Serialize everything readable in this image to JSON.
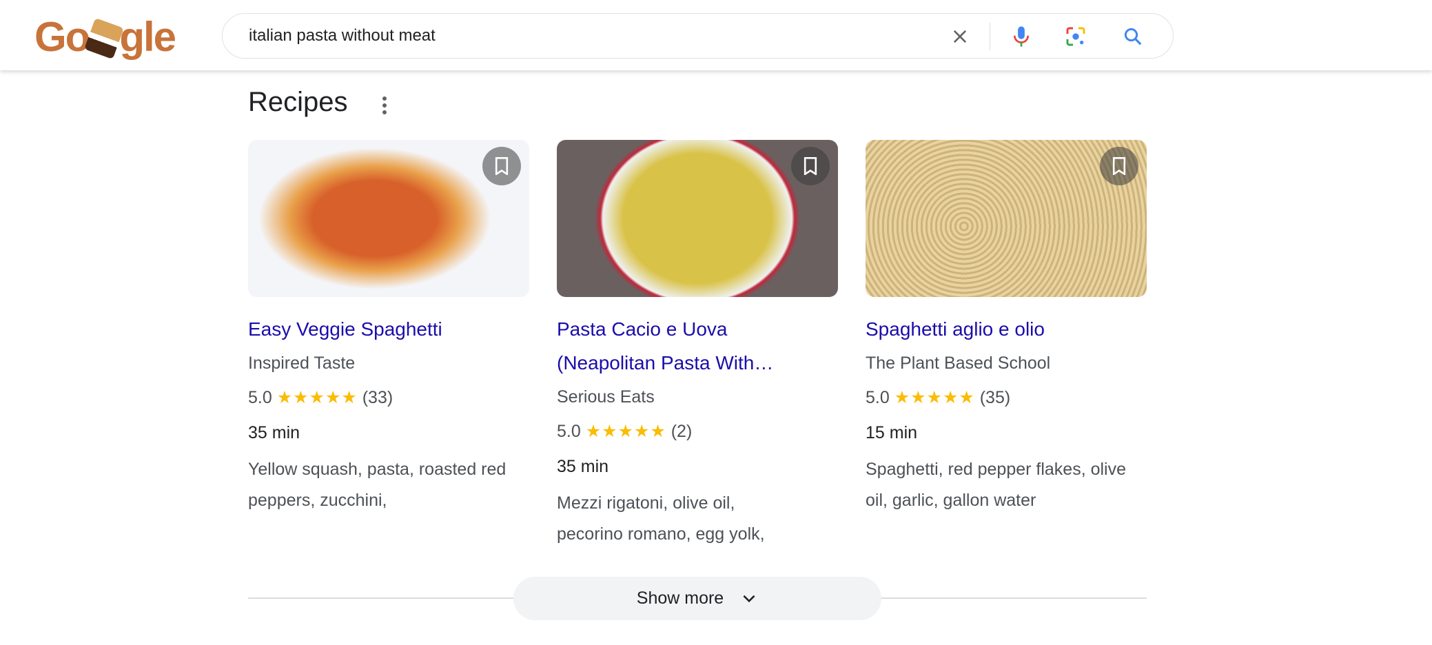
{
  "header": {
    "logo_text": "Google",
    "search_value": "italian pasta without meat",
    "icons": [
      "close-icon",
      "mic-icon",
      "lens-icon",
      "search-icon"
    ]
  },
  "section": {
    "title": "Recipes"
  },
  "recipes": [
    {
      "title": "Easy Veggie Spaghetti",
      "source": "Inspired Taste",
      "rating": "5.0",
      "stars": "★★★★★",
      "reviews": "(33)",
      "time": "35 min",
      "ingredients": "Yellow squash, pasta, roasted red peppers, zucchini,"
    },
    {
      "title": "Pasta Cacio e Uova (Neapolitan Pasta With…",
      "source": "Serious Eats",
      "rating": "5.0",
      "stars": "★★★★★",
      "reviews": "(2)",
      "time": "35 min",
      "ingredients": "Mezzi rigatoni, olive oil, pecorino romano, egg yolk,"
    },
    {
      "title": "Spaghetti aglio e olio",
      "source": "The Plant Based School",
      "rating": "5.0",
      "stars": "★★★★★",
      "reviews": "(35)",
      "time": "15 min",
      "ingredients": "Spaghetti, red pepper flakes, olive oil, garlic, gallon water"
    }
  ],
  "show_more": "Show more",
  "colors": {
    "link": "#1a0dab",
    "star": "#fbbc04",
    "secondary_text": "#4d5156"
  }
}
